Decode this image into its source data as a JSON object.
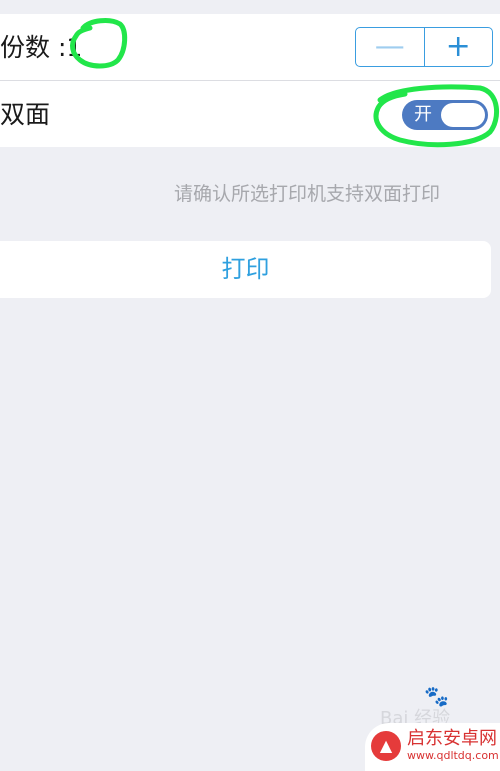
{
  "copies_row": {
    "label": "份数 :1",
    "minus": "—",
    "plus": "+"
  },
  "duplex_row": {
    "label": "双面",
    "toggle_text": "开"
  },
  "hint": "请确认所选打印机支持双面打印",
  "print_button": "打印",
  "watermark": {
    "text": "Bai 经验"
  },
  "brand": {
    "name": "启东安卓网",
    "url": "www.qdltdq.com"
  },
  "colors": {
    "accent": "#2fa0df",
    "toggle": "#4d7ac2",
    "highlight": "#22e64a"
  }
}
